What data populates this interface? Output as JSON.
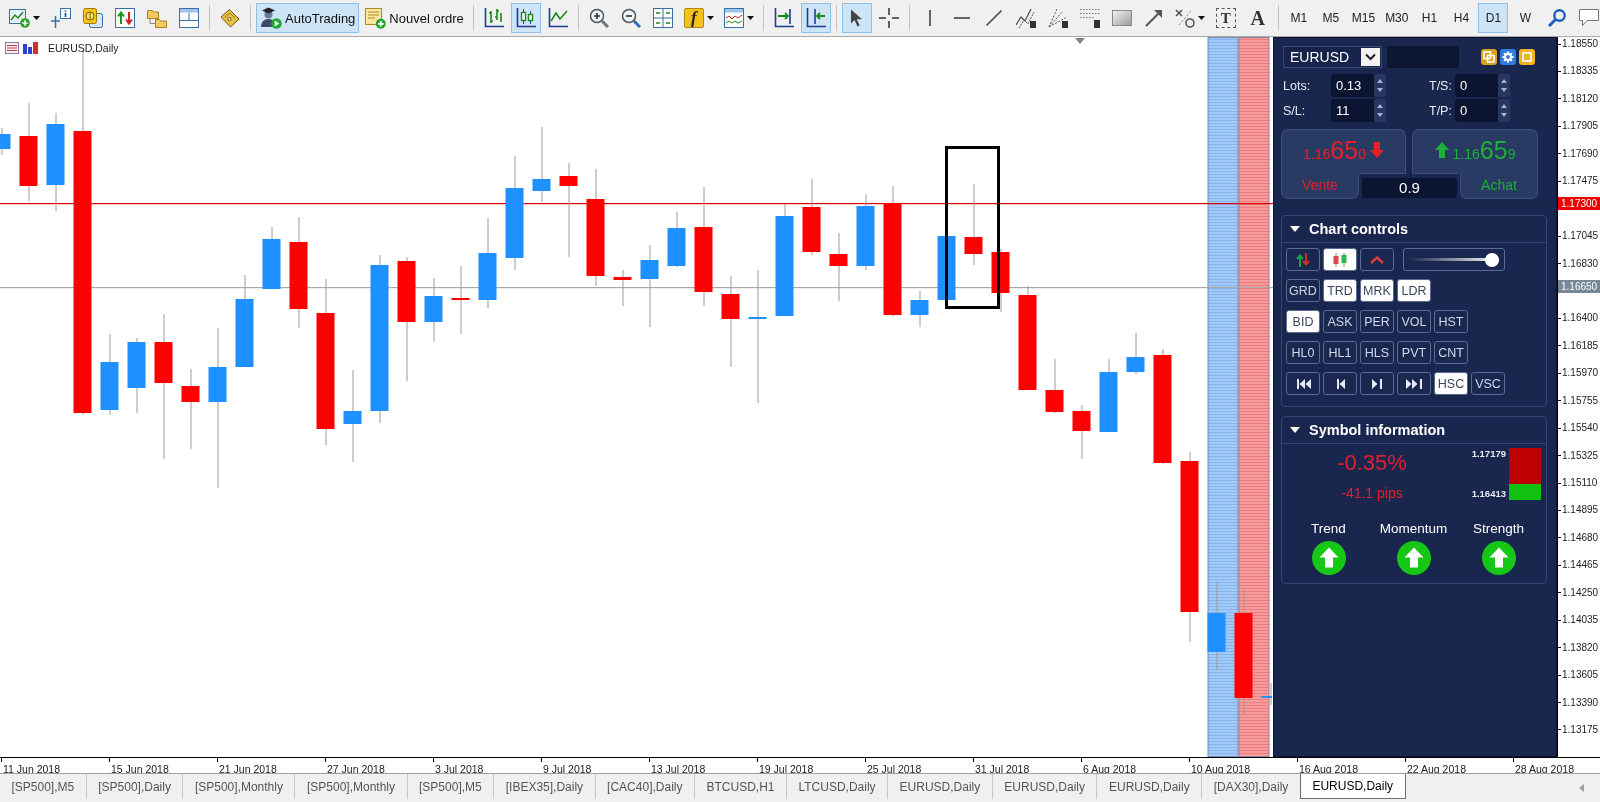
{
  "toolbar": {
    "autotrading": {
      "label": "AutoTrading",
      "selected": true
    },
    "new_order": {
      "label": "Nouvel ordre"
    },
    "chart_types": [
      {
        "selected": false
      },
      {
        "selected": true
      },
      {
        "selected": false
      }
    ],
    "indicators": {
      "glyph": "f"
    },
    "chart_shift": {
      "selected": false
    },
    "auto_scroll": {
      "selected": true
    },
    "pointer_tools": [
      {
        "selected": true
      },
      {
        "selected": false
      }
    ],
    "text_tools": [
      {
        "glyph": "T"
      },
      {
        "glyph": "A"
      }
    ],
    "timeframes": [
      {
        "label": "M1",
        "selected": false
      },
      {
        "label": "M5",
        "selected": false
      },
      {
        "label": "M15",
        "selected": false
      },
      {
        "label": "M30",
        "selected": false
      },
      {
        "label": "H1",
        "selected": false
      },
      {
        "label": "H4",
        "selected": false
      },
      {
        "label": "D1",
        "selected": true
      },
      {
        "label": "W",
        "selected": false
      }
    ]
  },
  "chart": {
    "title": "EURUSD,Daily",
    "price_axis": [
      {
        "kind": "tick",
        "text": "1.18550"
      },
      {
        "kind": "tick",
        "text": "1.18335"
      },
      {
        "kind": "tick",
        "text": "1.18120"
      },
      {
        "kind": "tick",
        "text": "1.17905"
      },
      {
        "kind": "tick",
        "text": "1.17690"
      },
      {
        "kind": "tick",
        "text": "1.17475"
      },
      {
        "kind": "level",
        "text": "1.17300"
      },
      {
        "kind": "tick",
        "text": "1.17045"
      },
      {
        "kind": "tick",
        "text": "1.16830"
      },
      {
        "kind": "bid",
        "text": "1.16650"
      },
      {
        "kind": "tick",
        "text": "1.16400"
      },
      {
        "kind": "tick",
        "text": "1.16185"
      },
      {
        "kind": "tick",
        "text": "1.15970"
      },
      {
        "kind": "tick",
        "text": "1.15755"
      },
      {
        "kind": "tick",
        "text": "1.15540"
      },
      {
        "kind": "tick",
        "text": "1.15325"
      },
      {
        "kind": "tick",
        "text": "1.15110"
      },
      {
        "kind": "tick",
        "text": "1.14895"
      },
      {
        "kind": "tick",
        "text": "1.14680"
      },
      {
        "kind": "tick",
        "text": "1.14465"
      },
      {
        "kind": "tick",
        "text": "1.14250"
      },
      {
        "kind": "tick",
        "text": "1.14035"
      },
      {
        "kind": "tick",
        "text": "1.13820"
      },
      {
        "kind": "tick",
        "text": "1.13605"
      },
      {
        "kind": "tick",
        "text": "1.13390"
      },
      {
        "kind": "tick",
        "text": "1.13175"
      }
    ],
    "date_axis": [
      "11 Jun 2018",
      "15 Jun 2018",
      "21 Jun 2018",
      "27 Jun 2018",
      "3 Jul 2018",
      "9 Jul 2018",
      "13 Jul 2018",
      "19 Jul 2018",
      "25 Jul 2018",
      "31 Jul 2018",
      "6 Aug 2018",
      "10 Aug 2018",
      "16 Aug 2018",
      "22 Aug 2018",
      "28 Aug 2018"
    ]
  },
  "trade_panel": {
    "symbol": "EURUSD",
    "fields": [
      {
        "label": "Lots:",
        "value": "0.13"
      },
      {
        "label": "T/S:",
        "value": "0"
      },
      {
        "label": "S/L:",
        "value": "11"
      },
      {
        "label": "T/P:",
        "value": "0"
      }
    ],
    "quotes": [
      {
        "kind": "sell",
        "price_head": "1.16",
        "price_pips": "65",
        "price_tail": "0",
        "label": "Vente"
      },
      {
        "kind": "buy",
        "price_head": "1.16",
        "price_pips": "65",
        "price_tail": "9",
        "label": "Achat"
      }
    ],
    "spread": "0.9"
  },
  "chart_controls": {
    "title": "Chart controls",
    "expanded": true,
    "view_buttons": [
      {
        "selected": false
      },
      {
        "selected": true
      },
      {
        "selected": false
      }
    ],
    "zoom_slider": {
      "level": 1
    },
    "toggle_rows": [
      [
        {
          "label": "GRD",
          "selected": false
        },
        {
          "label": "TRD",
          "selected": true
        },
        {
          "label": "MRK",
          "selected": true
        },
        {
          "label": "LDR",
          "selected": true
        }
      ],
      [
        {
          "label": "BID",
          "selected": true
        },
        {
          "label": "ASK",
          "selected": false
        },
        {
          "label": "PER",
          "selected": false
        },
        {
          "label": "VOL",
          "selected": false
        },
        {
          "label": "HST",
          "selected": false
        }
      ],
      [
        {
          "label": "HL0",
          "selected": false
        },
        {
          "label": "HL1",
          "selected": false
        },
        {
          "label": "HLS",
          "selected": false
        },
        {
          "label": "PVT",
          "selected": false
        },
        {
          "label": "CNT",
          "selected": false
        }
      ]
    ],
    "scale_buttons": [
      {
        "label": "HSC",
        "selected": true
      },
      {
        "label": "VSC",
        "selected": false
      }
    ]
  },
  "symbol_info": {
    "title": "Symbol information",
    "expanded": true,
    "change": {
      "negative": true,
      "percent": "-0.35%",
      "pips": "-41.1 pips"
    },
    "range": {
      "high": "1.17179",
      "low": "1.16413",
      "level": 0.31
    },
    "indicators": [
      {
        "label": "Trend",
        "rising": true
      },
      {
        "label": "Momentum",
        "rising": true
      },
      {
        "label": "Strength",
        "rising": true
      }
    ]
  },
  "chart_tabs": [
    {
      "label": "[SP500],M5",
      "selected": false
    },
    {
      "label": "[SP500],Daily",
      "selected": false
    },
    {
      "label": "[SP500],Monthly",
      "selected": false
    },
    {
      "label": "[SP500],Monthly",
      "selected": false
    },
    {
      "label": "[SP500],M5",
      "selected": false
    },
    {
      "label": "[IBEX35],Daily",
      "selected": false
    },
    {
      "label": "[CAC40],Daily",
      "selected": false
    },
    {
      "label": "BTCUSD,H1",
      "selected": false
    },
    {
      "label": "LTCUSD,Daily",
      "selected": false
    },
    {
      "label": "EURUSD,Daily",
      "selected": false
    },
    {
      "label": "EURUSD,Daily",
      "selected": false
    },
    {
      "label": "EURUSD,Daily",
      "selected": false
    },
    {
      "label": "[DAX30],Daily",
      "selected": false
    },
    {
      "label": "EURUSD,Daily",
      "selected": true
    }
  ]
}
